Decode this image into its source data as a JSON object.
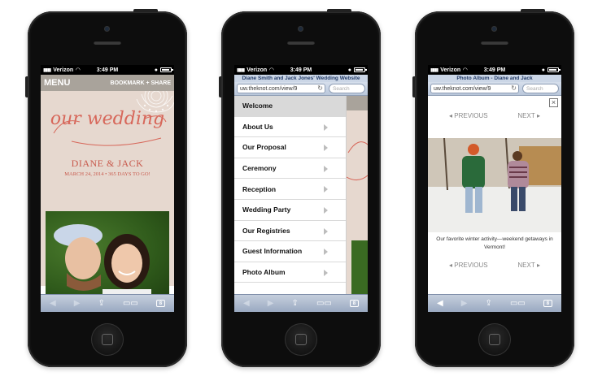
{
  "status": {
    "carrier": "Verizon",
    "time": "3:49 PM"
  },
  "phone1": {
    "menu_label": "MENU",
    "bookmark_share": "BOOKMARK + SHARE",
    "headline": "our wedding",
    "names": "DIANE & JACK",
    "date_line": "MARCH 24, 2014 • 365 DAYS TO GO!"
  },
  "phone2": {
    "page_title": "Diane Smith and Jack Jones' Wedding Website",
    "url": "uw.theknot.com/view/9",
    "search_placeholder": "Search",
    "menu_items": [
      "Welcome",
      "About Us",
      "Our Proposal",
      "Ceremony",
      "Reception",
      "Wedding Party",
      "Our Registries",
      "Guest Information",
      "Photo Album"
    ]
  },
  "phone3": {
    "page_title": "Photo Album - Diane and Jack",
    "url": "uw.theknot.com/view/9",
    "search_placeholder": "Search",
    "previous_label": "PREVIOUS",
    "next_label": "NEXT",
    "caption": "Our favorite winter activity—weekend getaways in Vermont!"
  },
  "toolbar": {
    "tabs_count": "8"
  },
  "colors": {
    "accent": "#d7675a",
    "menubar": "#a9a39b",
    "blush": "#e6d8cf",
    "safari_bar": "#b9c7db"
  }
}
